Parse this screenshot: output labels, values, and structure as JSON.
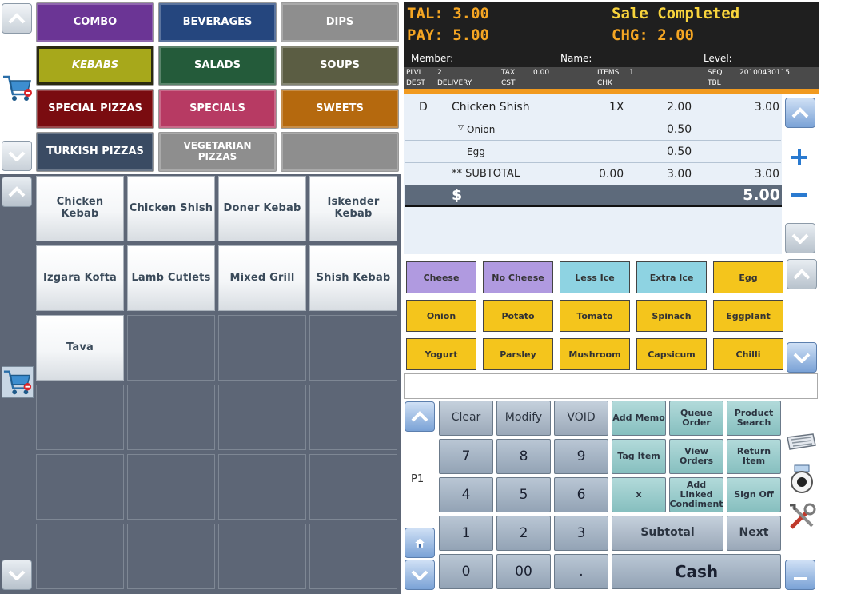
{
  "categories": [
    {
      "label": "COMBO",
      "color": "#6b3595"
    },
    {
      "label": "BEVERAGES",
      "color": "#25467e"
    },
    {
      "label": "DIPS",
      "color": "#8e8e8e"
    },
    {
      "label": "KEBABS",
      "color": "#a7a81b"
    },
    {
      "label": "SALADS",
      "color": "#245b3a"
    },
    {
      "label": "SOUPS",
      "color": "#5b5d43"
    },
    {
      "label": "SPECIAL PIZZAS",
      "color": "#7a0c10"
    },
    {
      "label": "SPECIALS",
      "color": "#b73a63"
    },
    {
      "label": "SWEETS",
      "color": "#b5690e"
    },
    {
      "label": "TURKISH PIZZAS",
      "color": "#3a4b63"
    },
    {
      "label": "VEGETARIAN PIZZAS",
      "color": "#8e8e8e"
    },
    {
      "label": "",
      "color": "#8e8e8e"
    }
  ],
  "products": [
    "Chicken Kebab",
    "Chicken Shish",
    "Doner Kebab",
    "Iskender Kebab",
    "Izgara Kofta",
    "Lamb Cutlets",
    "Mixed Grill",
    "Shish Kebab",
    "Tava"
  ],
  "header": {
    "tal": "TAL: 3.00",
    "pay": "PAY: 5.00",
    "status": "Sale Completed",
    "chg": "CHG: 2.00",
    "member": "Member:",
    "name": "Name:",
    "level": "Level:",
    "plvl_label": "PLVL",
    "plvl": "2",
    "dest_label": "DEST",
    "dest": "DELIVERY",
    "tax_label": "TAX",
    "tax": "0.00",
    "cst_label": "CST",
    "items_label": "ITEMS",
    "items": "1",
    "chk_label": "CHK",
    "seq_label": "SEQ",
    "seq": "20100430115",
    "tbl_label": "TBL"
  },
  "receipt": {
    "lines": [
      {
        "flag": "D",
        "desc": "Chicken Shish",
        "qty": "1X",
        "price": "2.00",
        "amount": "3.00"
      },
      {
        "flag": "",
        "desc": "Onion",
        "qty": "",
        "price": "0.50",
        "amount": ""
      },
      {
        "flag": "",
        "desc": "Egg",
        "qty": "",
        "price": "0.50",
        "amount": ""
      },
      {
        "flag": "",
        "desc": "** SUBTOTAL",
        "qty": "0.00",
        "price": "3.00",
        "amount": "3.00"
      }
    ],
    "tender_symbol": "$",
    "tender_amount": "5.00"
  },
  "modifiers": [
    {
      "label": "Cheese",
      "color": "#b09ae0"
    },
    {
      "label": "No Cheese",
      "color": "#b09ae0"
    },
    {
      "label": "Less Ice",
      "color": "#8ed3e2"
    },
    {
      "label": "Extra Ice",
      "color": "#8ed3e2"
    },
    {
      "label": "Egg",
      "color": "#f4c51c"
    },
    {
      "label": "Onion",
      "color": "#f4c51c"
    },
    {
      "label": "Potato",
      "color": "#f4c51c"
    },
    {
      "label": "Tomato",
      "color": "#f4c51c"
    },
    {
      "label": "Spinach",
      "color": "#f4c51c"
    },
    {
      "label": "Eggplant",
      "color": "#f4c51c"
    },
    {
      "label": "Yogurt",
      "color": "#f4c51c"
    },
    {
      "label": "Parsley",
      "color": "#f4c51c"
    },
    {
      "label": "Mushroom",
      "color": "#f4c51c"
    },
    {
      "label": "Capsicum",
      "color": "#f4c51c"
    },
    {
      "label": "Chilli",
      "color": "#f4c51c"
    }
  ],
  "keypad": {
    "page": "P1",
    "clear": "Clear",
    "modify": "Modify",
    "void": "VOID",
    "add_memo": "Add Memo",
    "queue_order": "Queue Order",
    "product_search": "Product Search",
    "k7": "7",
    "k8": "8",
    "k9": "9",
    "tag_item": "Tag Item",
    "view_orders": "View Orders",
    "return_item": "Return Item",
    "k4": "4",
    "k5": "5",
    "k6": "6",
    "x": "x",
    "add_linked": "Add Linked Condiment",
    "sign_off": "Sign Off",
    "k1": "1",
    "k2": "2",
    "k3": "3",
    "subtotal": "Subtotal",
    "next": "Next",
    "k0": "0",
    "k00": "00",
    "dot": ".",
    "cash": "Cash"
  },
  "icons": {
    "cart": "shopping-cart-icon",
    "keyboard": "keyboard-icon",
    "timer": "timer-icon",
    "tools": "tools-icon",
    "home": "home-icon"
  }
}
